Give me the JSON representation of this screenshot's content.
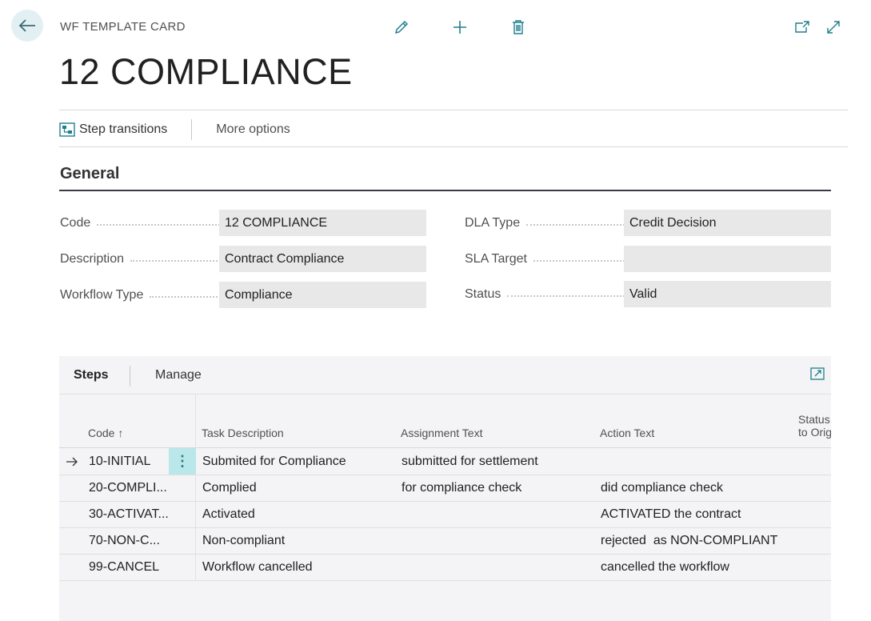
{
  "header": {
    "caption": "WF TEMPLATE CARD",
    "title": "12 COMPLIANCE",
    "toolbar_icons": [
      "edit-pencil-icon",
      "add-plus-icon",
      "delete-trash-icon",
      "open-new-window-icon",
      "expand-icon"
    ]
  },
  "actions": {
    "step_transitions": "Step transitions",
    "more_options": "More options"
  },
  "general": {
    "title": "General",
    "fields_left": [
      {
        "label": "Code",
        "value": "12 COMPLIANCE"
      },
      {
        "label": "Description",
        "value": "Contract Compliance"
      },
      {
        "label": "Workflow Type",
        "value": "Compliance"
      }
    ],
    "fields_right": [
      {
        "label": "DLA Type",
        "value": "Credit Decision"
      },
      {
        "label": "SLA Target",
        "value": ""
      },
      {
        "label": "Status",
        "value": "Valid"
      }
    ]
  },
  "steps": {
    "tab_steps": "Steps",
    "tab_manage": "Manage",
    "columns": {
      "code": "Code ↑",
      "task_description": "Task Description",
      "assignment_text": "Assignment Text",
      "action_text": "Action Text",
      "status_line1": "Status",
      "status_line2": "to Orig"
    },
    "rows": [
      {
        "code": "10-INITIAL",
        "task": "Submited for Compliance",
        "assignment": "submitted for settlement",
        "action": ""
      },
      {
        "code": "20-COMPLI...",
        "task": "Complied",
        "assignment": "for compliance check",
        "action": "did compliance check"
      },
      {
        "code": "30-ACTIVAT...",
        "task": "Activated",
        "assignment": "",
        "action": "ACTIVATED the contract"
      },
      {
        "code": "70-NON-C...",
        "task": "Non-compliant",
        "assignment": "",
        "action": "rejected  as NON-COMPLIANT"
      },
      {
        "code": "99-CANCEL",
        "task": "Workflow cancelled",
        "assignment": "",
        "action": "cancelled the workflow"
      }
    ]
  }
}
